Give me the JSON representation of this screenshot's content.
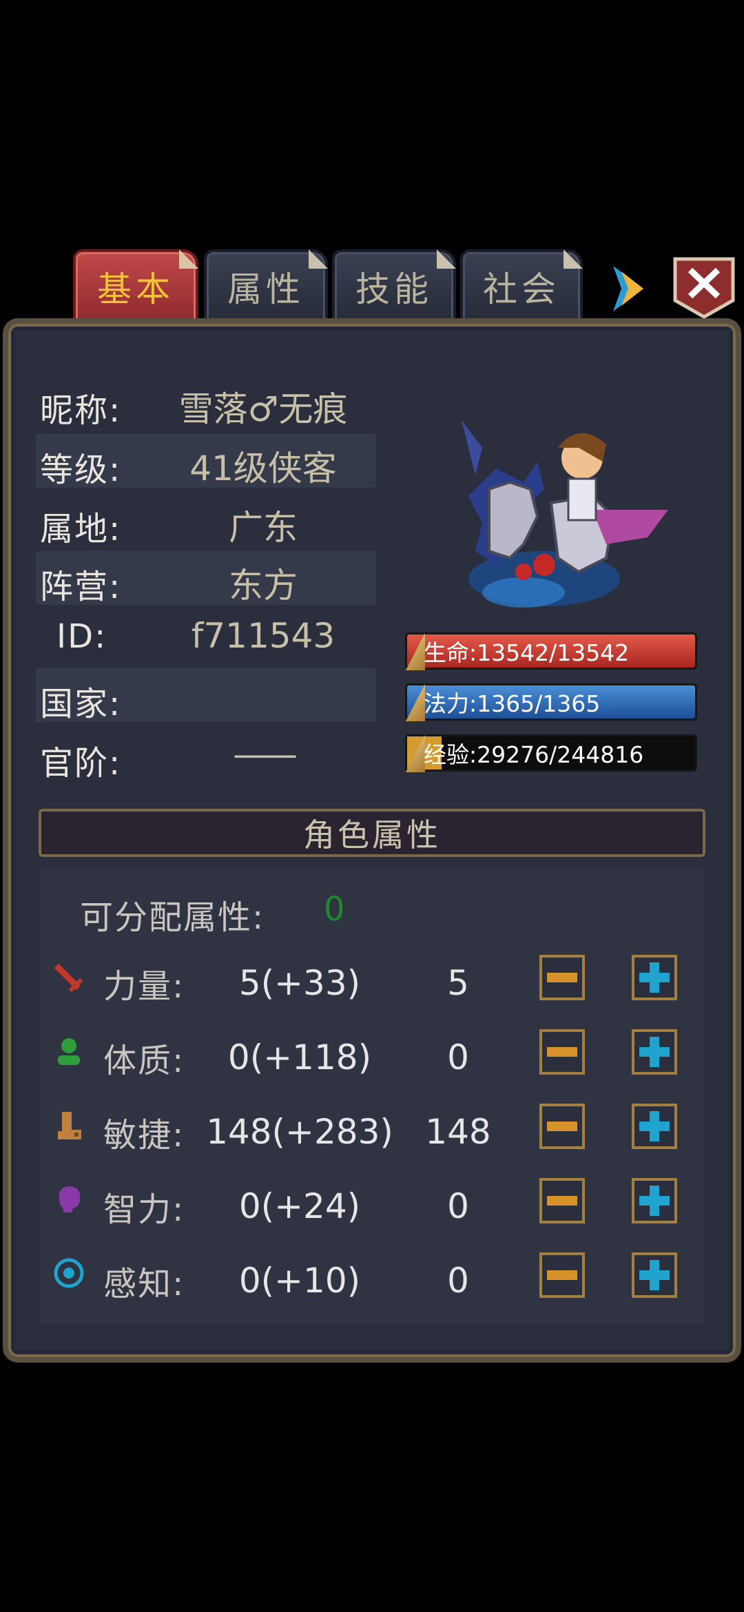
{
  "tabs": [
    {
      "label": "基本"
    },
    {
      "label": "属性"
    },
    {
      "label": "技能"
    },
    {
      "label": "社会"
    }
  ],
  "info": {
    "nickname_label": "昵称:",
    "nickname": "雪落♂无痕",
    "level_label": "等级:",
    "level": "41级侠客",
    "region_label": "属地:",
    "region": "广东",
    "camp_label": "阵营:",
    "camp": "东方",
    "id_label": "ID:",
    "id": "f711543",
    "country_label": "国家:",
    "country": "",
    "rank_label": "官阶:",
    "rank": "——"
  },
  "bars": {
    "hp": "生命:13542/13542",
    "mp": "法力:1365/1365",
    "exp": "经验:29276/244816",
    "hp_fill": 1.0,
    "mp_fill": 1.0,
    "exp_fill": 0.1196
  },
  "attributes": {
    "header": "角色属性",
    "unallocated_label": "可分配属性:",
    "unallocated": "0",
    "rows": [
      {
        "label": "力量:",
        "value": "5(+33)",
        "alloc": "5",
        "icon": "sword-icon"
      },
      {
        "label": "体质:",
        "value": "0(+118)",
        "alloc": "0",
        "icon": "person-icon"
      },
      {
        "label": "敏捷:",
        "value": "148(+283)",
        "alloc": "148",
        "icon": "boot-icon"
      },
      {
        "label": "智力:",
        "value": "0(+24)",
        "alloc": "0",
        "icon": "brain-icon"
      },
      {
        "label": "感知:",
        "value": "0(+10)",
        "alloc": "0",
        "icon": "eye-icon"
      }
    ]
  },
  "colors": {
    "tab_active_text": "#f3c23c",
    "hp": "#c0392b",
    "mp": "#2a69b0",
    "exp": "#111111",
    "unallocated": "#1f8a2a"
  }
}
